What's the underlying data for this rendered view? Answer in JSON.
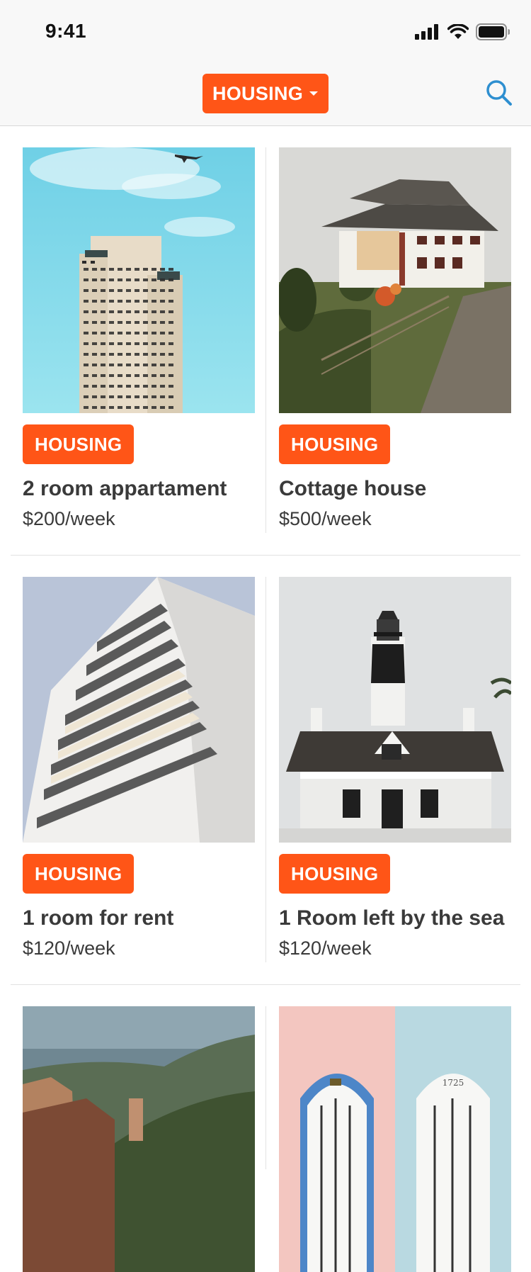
{
  "status_bar": {
    "time": "9:41"
  },
  "nav": {
    "category_label": "HOUSING"
  },
  "listings": [
    {
      "tag": "HOUSING",
      "title": "2 room appartament",
      "price": "$200/week"
    },
    {
      "tag": "HOUSING",
      "title": "Cottage house",
      "price": "$500/week"
    },
    {
      "tag": "HOUSING",
      "title": "1 room for rent",
      "price": "$120/week"
    },
    {
      "tag": "HOUSING",
      "title": "1 Room left by the sea",
      "price": "$120/week"
    }
  ],
  "photo_texts": {
    "house_number": "1725"
  },
  "colors": {
    "accent": "#ff5517",
    "search_icon": "#2e8fd0"
  }
}
